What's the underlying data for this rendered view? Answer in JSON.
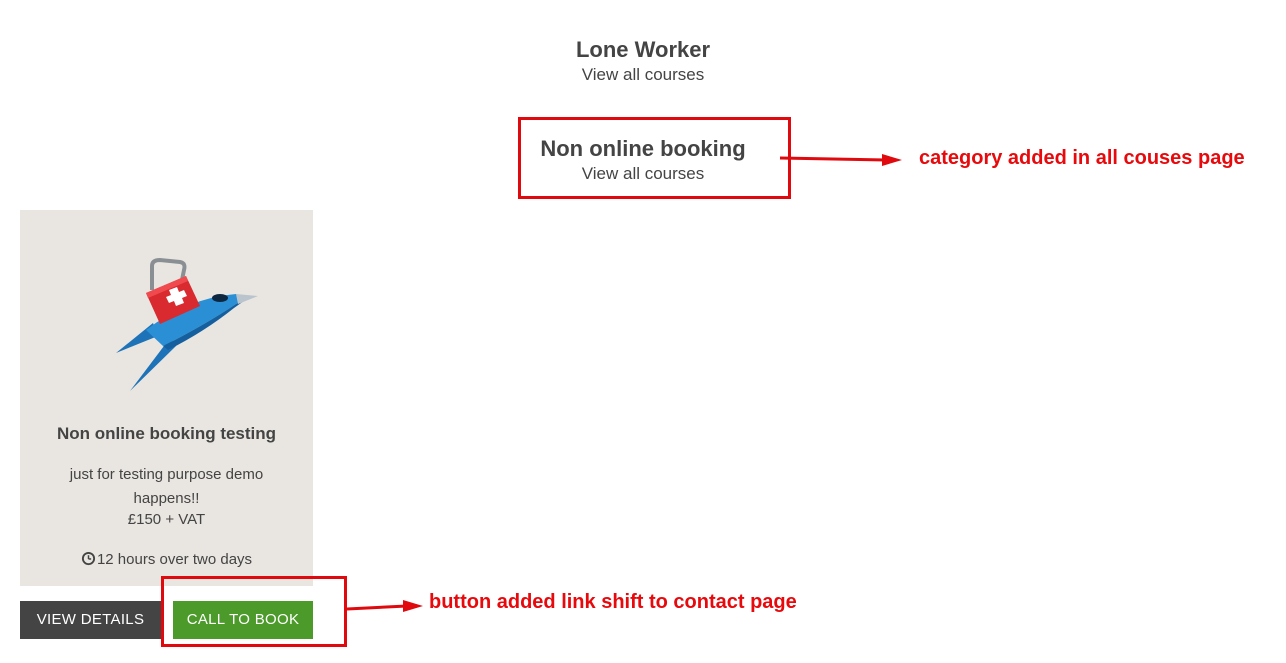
{
  "categories": [
    {
      "title": "Lone Worker",
      "link": "View all courses"
    },
    {
      "title": "Non online booking",
      "link": "View all courses"
    }
  ],
  "course": {
    "title": "Non online booking testing",
    "description": "just for testing purpose demo happens!!",
    "price": "£150 + VAT",
    "duration": "12 hours over two days",
    "illustration_icon": "first-aid-rocket-icon",
    "duration_icon": "clock-icon"
  },
  "buttons": {
    "details": "VIEW DETAILS",
    "call": "CALL TO BOOK"
  },
  "annotations": {
    "category": "category added in all couses page",
    "button": "button added link shift to contact page",
    "color": "#e0090d"
  },
  "colors": {
    "card_bg": "#e9e6e1",
    "details_button": "#444444",
    "call_button": "#4b9a2a"
  }
}
